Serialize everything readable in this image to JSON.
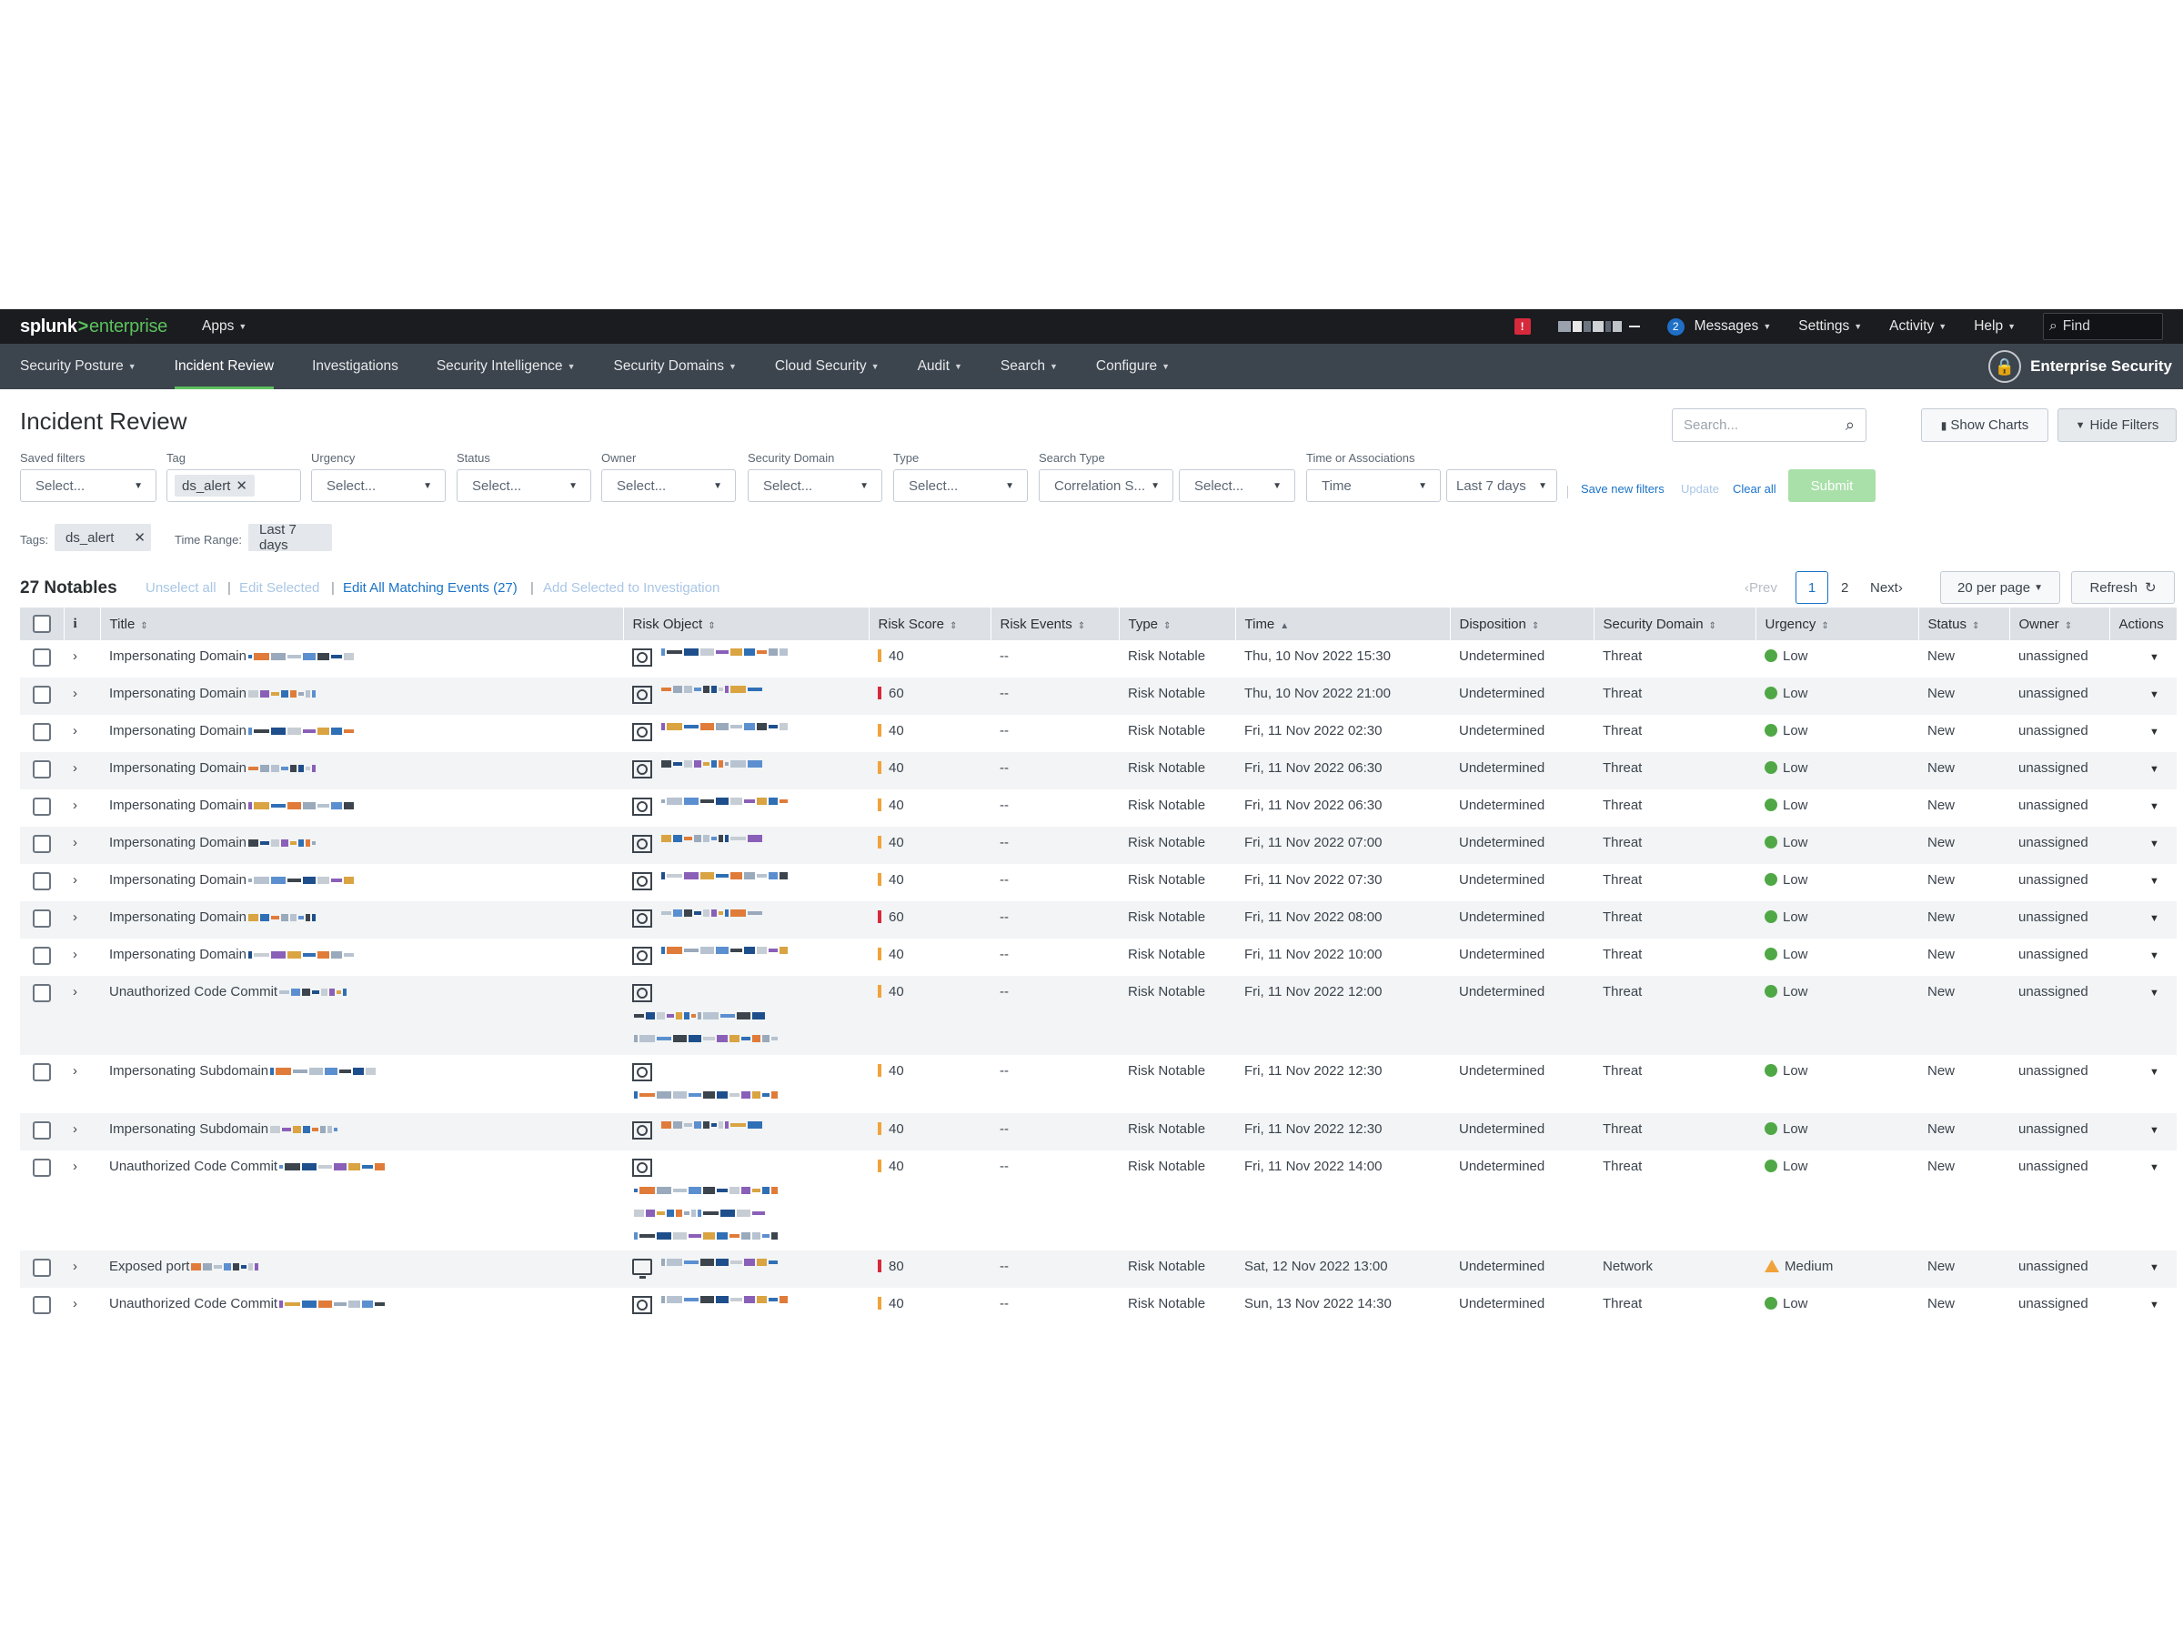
{
  "topbar": {
    "logo_splunk": "splunk",
    "logo_gt": ">",
    "logo_enterprise": "enterprise",
    "apps": "Apps",
    "alert_badge": "!",
    "messages_count": "2",
    "messages": "Messages",
    "settings": "Settings",
    "activity": "Activity",
    "help": "Help",
    "find_placeholder": "Find"
  },
  "appnav": {
    "items": [
      "Security Posture",
      "Incident Review",
      "Investigations",
      "Security Intelligence",
      "Security Domains",
      "Cloud Security",
      "Audit",
      "Search",
      "Configure"
    ],
    "active": "Incident Review",
    "brand": "Enterprise Security"
  },
  "page": {
    "title": "Incident Review",
    "search_placeholder": "Search...",
    "show_charts": "Show Charts",
    "hide_filters": "Hide Filters"
  },
  "filters": {
    "saved_filters": {
      "label": "Saved filters",
      "value": "Select..."
    },
    "tag": {
      "label": "Tag",
      "value": "ds_alert"
    },
    "urgency": {
      "label": "Urgency",
      "value": "Select..."
    },
    "status": {
      "label": "Status",
      "value": "Select..."
    },
    "owner": {
      "label": "Owner",
      "value": "Select..."
    },
    "security_domain": {
      "label": "Security Domain",
      "value": "Select..."
    },
    "type": {
      "label": "Type",
      "value": "Select..."
    },
    "search_type": {
      "label": "Search Type",
      "value": "Correlation S...",
      "value2": "Select..."
    },
    "time": {
      "label": "Time or Associations",
      "value": "Time",
      "range": "Last 7 days"
    },
    "save_new_filters": "Save new filters",
    "update": "Update",
    "clear_all": "Clear all",
    "submit": "Submit"
  },
  "applied": {
    "tags_label": "Tags:",
    "tags_value": "ds_alert",
    "time_label": "Time Range:",
    "time_value": "Last 7 days"
  },
  "notables": {
    "count": "27 Notables",
    "unselect_all": "Unselect all",
    "edit_selected": "Edit Selected",
    "edit_all": "Edit All Matching Events (27)",
    "add_to_investigation": "Add Selected to Investigation",
    "sep": "|",
    "prev": "Prev",
    "page1": "1",
    "page2": "2",
    "next": "Next",
    "per_page": "20 per page",
    "refresh": "Refresh"
  },
  "table": {
    "columns": [
      "Title",
      "Risk Object",
      "Risk Score",
      "Risk Events",
      "Type",
      "Time",
      "Disposition",
      "Security Domain",
      "Urgency",
      "Status",
      "Owner",
      "Actions"
    ],
    "info_icon": "i",
    "rows": [
      {
        "title": "Impersonating Domain",
        "risk": "40",
        "events": "--",
        "type": "Risk Notable",
        "time": "Thu, 10 Nov 2022 15:30",
        "disposition": "Undetermined",
        "domain": "Threat",
        "urgency": "Low",
        "status": "New",
        "owner": "unassigned"
      },
      {
        "title": "Impersonating Domain",
        "risk": "60",
        "events": "--",
        "type": "Risk Notable",
        "time": "Thu, 10 Nov 2022 21:00",
        "disposition": "Undetermined",
        "domain": "Threat",
        "urgency": "Low",
        "status": "New",
        "owner": "unassigned"
      },
      {
        "title": "Impersonating Domain",
        "risk": "40",
        "events": "--",
        "type": "Risk Notable",
        "time": "Fri, 11 Nov 2022 02:30",
        "disposition": "Undetermined",
        "domain": "Threat",
        "urgency": "Low",
        "status": "New",
        "owner": "unassigned"
      },
      {
        "title": "Impersonating Domain",
        "risk": "40",
        "events": "--",
        "type": "Risk Notable",
        "time": "Fri, 11 Nov 2022 06:30",
        "disposition": "Undetermined",
        "domain": "Threat",
        "urgency": "Low",
        "status": "New",
        "owner": "unassigned"
      },
      {
        "title": "Impersonating Domain",
        "risk": "40",
        "events": "--",
        "type": "Risk Notable",
        "time": "Fri, 11 Nov 2022 06:30",
        "disposition": "Undetermined",
        "domain": "Threat",
        "urgency": "Low",
        "status": "New",
        "owner": "unassigned"
      },
      {
        "title": "Impersonating Domain",
        "risk": "40",
        "events": "--",
        "type": "Risk Notable",
        "time": "Fri, 11 Nov 2022 07:00",
        "disposition": "Undetermined",
        "domain": "Threat",
        "urgency": "Low",
        "status": "New",
        "owner": "unassigned"
      },
      {
        "title": "Impersonating Domain",
        "risk": "40",
        "events": "--",
        "type": "Risk Notable",
        "time": "Fri, 11 Nov 2022 07:30",
        "disposition": "Undetermined",
        "domain": "Threat",
        "urgency": "Low",
        "status": "New",
        "owner": "unassigned"
      },
      {
        "title": "Impersonating Domain",
        "risk": "60",
        "events": "--",
        "type": "Risk Notable",
        "time": "Fri, 11 Nov 2022 08:00",
        "disposition": "Undetermined",
        "domain": "Threat",
        "urgency": "Low",
        "status": "New",
        "owner": "unassigned"
      },
      {
        "title": "Impersonating Domain",
        "risk": "40",
        "events": "--",
        "type": "Risk Notable",
        "time": "Fri, 11 Nov 2022 10:00",
        "disposition": "Undetermined",
        "domain": "Threat",
        "urgency": "Low",
        "status": "New",
        "owner": "unassigned"
      },
      {
        "title": "Unauthorized Code Commit",
        "risk": "40",
        "events": "--",
        "type": "Risk Notable",
        "time": "Fri, 11 Nov 2022 12:00",
        "disposition": "Undetermined",
        "domain": "Threat",
        "urgency": "Low",
        "status": "New",
        "owner": "unassigned"
      },
      {
        "title": "Impersonating Subdomain",
        "risk": "40",
        "events": "--",
        "type": "Risk Notable",
        "time": "Fri, 11 Nov 2022 12:30",
        "disposition": "Undetermined",
        "domain": "Threat",
        "urgency": "Low",
        "status": "New",
        "owner": "unassigned"
      },
      {
        "title": "Impersonating Subdomain",
        "risk": "40",
        "events": "--",
        "type": "Risk Notable",
        "time": "Fri, 11 Nov 2022 12:30",
        "disposition": "Undetermined",
        "domain": "Threat",
        "urgency": "Low",
        "status": "New",
        "owner": "unassigned"
      },
      {
        "title": "Unauthorized Code Commit",
        "risk": "40",
        "events": "--",
        "type": "Risk Notable",
        "time": "Fri, 11 Nov 2022 14:00",
        "disposition": "Undetermined",
        "domain": "Threat",
        "urgency": "Low",
        "status": "New",
        "owner": "unassigned"
      },
      {
        "title": "Exposed port",
        "risk": "80",
        "events": "--",
        "type": "Risk Notable",
        "time": "Sat, 12 Nov 2022 13:00",
        "disposition": "Undetermined",
        "domain": "Network",
        "urgency": "Medium",
        "status": "New",
        "owner": "unassigned"
      },
      {
        "title": "Unauthorized Code Commit",
        "risk": "40",
        "events": "--",
        "type": "Risk Notable",
        "time": "Sun, 13 Nov 2022 14:30",
        "disposition": "Undetermined",
        "domain": "Threat",
        "urgency": "Low",
        "status": "New",
        "owner": "unassigned"
      }
    ]
  },
  "colors": {
    "accent_green": "#5cc05c",
    "link_blue": "#1a73c8",
    "risk_orange": "#f1a33b",
    "risk_red": "#d6293c",
    "urgency_low": "#4fa845",
    "urgency_medium": "#f1a33b"
  }
}
